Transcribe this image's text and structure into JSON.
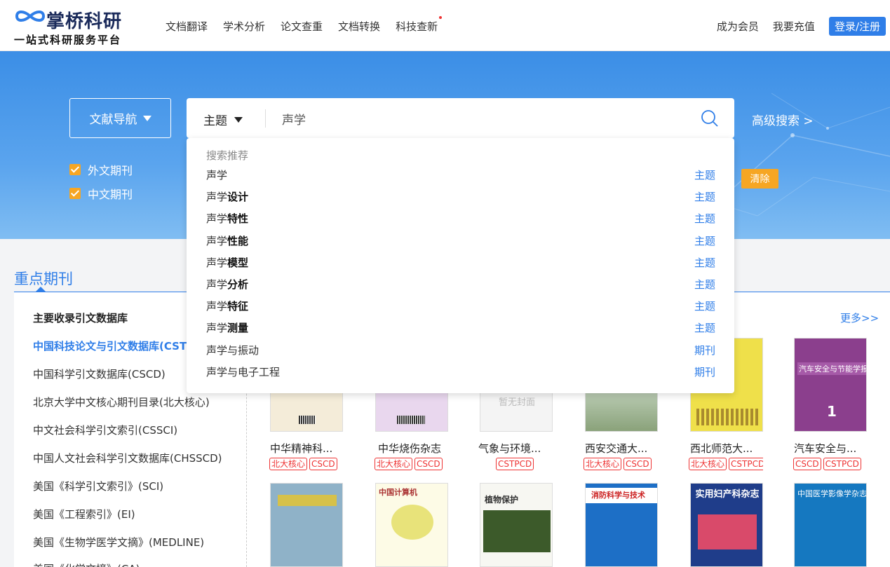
{
  "header": {
    "logo_title": "掌桥科研",
    "logo_sub": "一站式科研服务平台",
    "nav": [
      "文档翻译",
      "学术分析",
      "论文查重",
      "文档转换",
      "科技查新"
    ],
    "member": "成为会员",
    "recharge": "我要充值",
    "login": "登录/注册"
  },
  "search": {
    "nav_button": "文献导航",
    "field": "主题",
    "query": "声学",
    "advanced": "高级搜索 >",
    "filters": [
      "外文期刊",
      "中文期刊"
    ],
    "clear": "清除"
  },
  "suggestions": {
    "heading": "搜索推荐",
    "items": [
      {
        "prefix": "声学",
        "bold": "",
        "type": "主题"
      },
      {
        "prefix": "声学",
        "bold": "设计",
        "type": "主题"
      },
      {
        "prefix": "声学",
        "bold": "特性",
        "type": "主题"
      },
      {
        "prefix": "声学",
        "bold": "性能",
        "type": "主题"
      },
      {
        "prefix": "声学",
        "bold": "模型",
        "type": "主题"
      },
      {
        "prefix": "声学",
        "bold": "分析",
        "type": "主题"
      },
      {
        "prefix": "声学",
        "bold": "特征",
        "type": "主题"
      },
      {
        "prefix": "声学",
        "bold": "测量",
        "type": "主题"
      },
      {
        "prefix": "声学与振动",
        "bold": "",
        "type": "期刊"
      },
      {
        "prefix": "声学与电子工程",
        "bold": "",
        "type": "期刊"
      }
    ]
  },
  "section": {
    "title": "重点期刊",
    "left_heading": "主要收录引文数据库",
    "databases": [
      "中国科技论文与引文数据库(CSTPCD)",
      "中国科学引文数据库(CSCD)",
      "北京大学中文核心期刊目录(北大核心)",
      "中文社会科学引文索引(CSSCI)",
      "中国人文社会科学引文数据库(CHSSCD)",
      "美国《科学引文索引》(SCI)",
      "美国《工程索引》(EI)",
      "美国《生物学医学文摘》(MEDLINE)",
      "美国《化学文摘》(CA)"
    ],
    "more": "更多>>",
    "journals": [
      {
        "name": "中华精神科...",
        "tags": [
          "北大核心",
          "CSCD"
        ],
        "cover_color": "#f4ecd9"
      },
      {
        "name": "中华烧伤杂志",
        "tags": [
          "北大核心",
          "CSCD"
        ],
        "cover_color": "#e9d7ee"
      },
      {
        "name": "气象与环境...",
        "tags": [
          "CSTPCD"
        ],
        "cover_color": "#f2f2f2",
        "cover_text": "暂无封面"
      },
      {
        "name": "西安交通大...",
        "tags": [
          "北大核心",
          "CSCD"
        ],
        "cover_color": "#d8e4e8"
      },
      {
        "name": "西北师范大...",
        "tags": [
          "北大核心",
          "CSTPCD"
        ],
        "cover_color": "#efe04a"
      },
      {
        "name": "汽车安全与...",
        "tags": [
          "CSCD",
          "CSTPCD"
        ],
        "cover_color": "#8b3f8d"
      }
    ],
    "cover_titles": [
      "汽车安全与节能学报",
      "实用妇产科杂志",
      "中国医学影像学杂志",
      "植物保护",
      "中国计算机",
      "消防科学与技术"
    ]
  },
  "colors": {
    "accent": "#2f7ee8",
    "orange": "#f6a623",
    "tag_red": "#ee3333"
  }
}
